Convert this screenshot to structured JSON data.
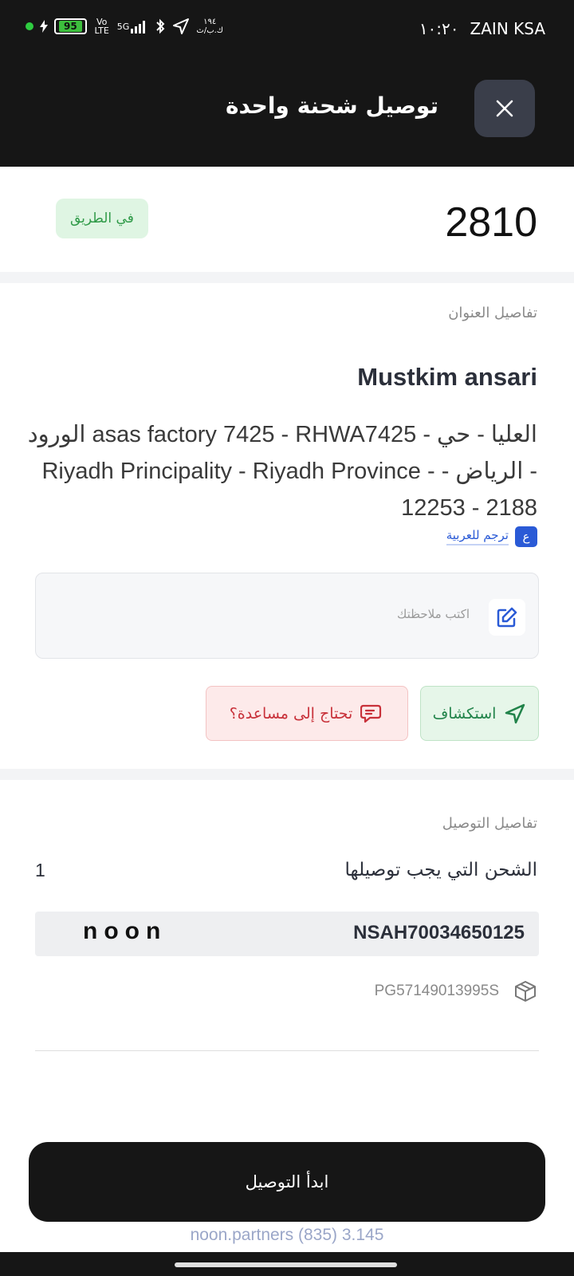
{
  "status_bar": {
    "carrier": "ZAIN KSA",
    "time": "١٠:٢٠",
    "battery": "95",
    "network": "5G",
    "volte": "Vo LTE",
    "data_rate": "١٩٤ ك.ب/ث"
  },
  "header": {
    "title": "توصيل شحنة واحدة",
    "close_icon": "close-icon"
  },
  "order": {
    "number": "2810",
    "status": "في الطريق"
  },
  "address_section": {
    "label": "تفاصيل العنوان",
    "customer_name": "Mustkim ansari",
    "address": "العليا - حي - asas factory 7425 - RHWA7425 الورود - الرياض - Riyadh Principality - Riyadh Province - 12253 - 2188",
    "translate_label": "ترجم للعربية",
    "translate_icon_glyph": "ع",
    "notes_placeholder": "اكتب ملاحظتك"
  },
  "actions": {
    "explore_label": "استكشاف",
    "help_label": "تحتاج إلى مساعدة؟"
  },
  "delivery_section": {
    "label": "تفاصيل التوصيل",
    "shipments_label": "الشحن التي يجب توصيلها",
    "shipments_count": "1",
    "shipment_id": "NSAH70034650125",
    "brand": "noon",
    "package_code": "PG57149013995S"
  },
  "footer": {
    "start_button": "ابدأ التوصيل",
    "version": "noon.partners (835) 3.145"
  },
  "colors": {
    "dark": "#161616",
    "success_bg": "#dff5e3",
    "success_text": "#2f9a48",
    "danger_bg": "#fdeaea",
    "danger_text": "#c8313a",
    "link": "#2a5ad6"
  }
}
